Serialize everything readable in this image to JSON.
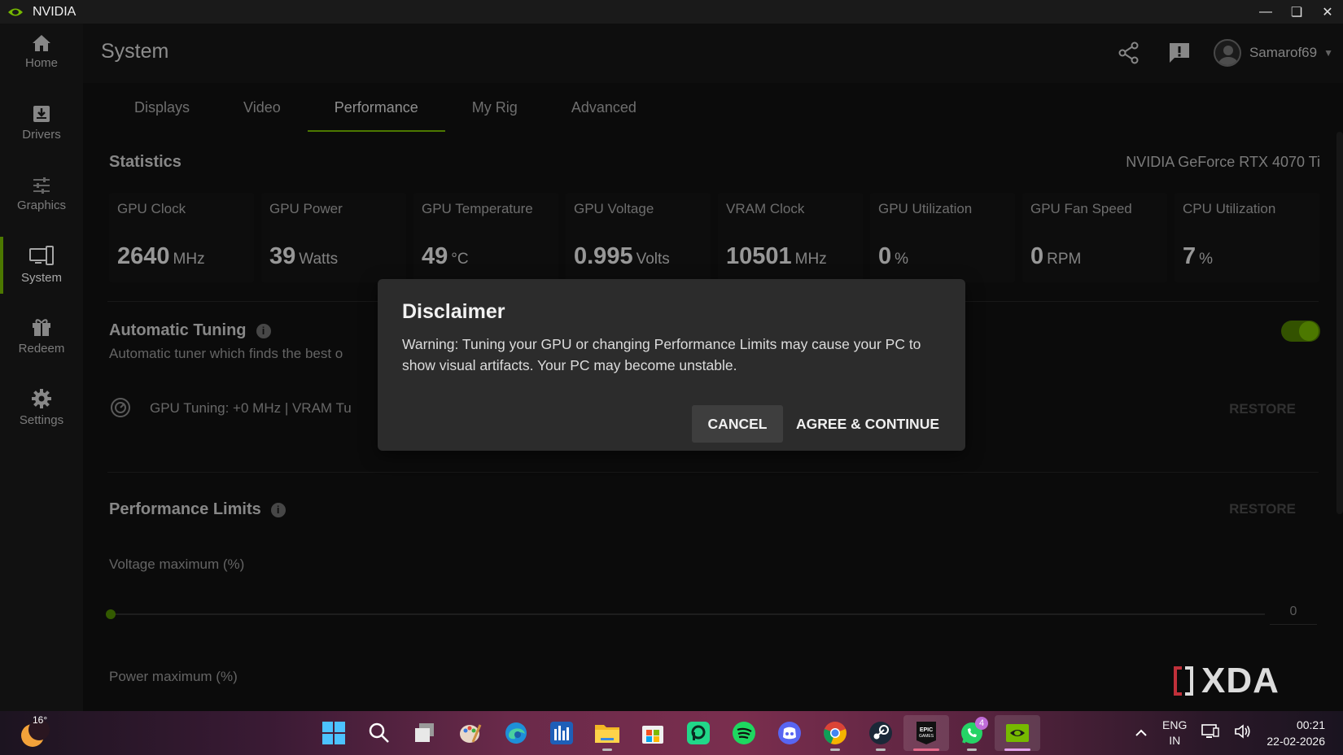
{
  "window": {
    "title": "NVIDIA"
  },
  "sidebar": {
    "items": [
      {
        "label": "Home",
        "icon": "home-icon"
      },
      {
        "label": "Drivers",
        "icon": "download-icon"
      },
      {
        "label": "Graphics",
        "icon": "sliders-icon"
      },
      {
        "label": "System",
        "icon": "system-icon",
        "active": true
      },
      {
        "label": "Redeem",
        "icon": "gift-icon"
      },
      {
        "label": "Settings",
        "icon": "gear-icon"
      }
    ]
  },
  "header": {
    "title": "System",
    "username": "Samarof69"
  },
  "tabs": [
    {
      "label": "Displays"
    },
    {
      "label": "Video"
    },
    {
      "label": "Performance",
      "active": true
    },
    {
      "label": "My Rig"
    },
    {
      "label": "Advanced"
    }
  ],
  "statistics": {
    "title": "Statistics",
    "gpu_name": "NVIDIA GeForce RTX 4070 Ti",
    "cards": [
      {
        "label": "GPU Clock",
        "value": "2640",
        "unit": "MHz"
      },
      {
        "label": "GPU Power",
        "value": "39",
        "unit": "Watts"
      },
      {
        "label": "GPU Temperature",
        "value": "49",
        "unit": "°C"
      },
      {
        "label": "GPU Voltage",
        "value": "0.995",
        "unit": "Volts"
      },
      {
        "label": "VRAM Clock",
        "value": "10501",
        "unit": "MHz"
      },
      {
        "label": "GPU Utilization",
        "value": "0",
        "unit": "%"
      },
      {
        "label": "GPU Fan Speed",
        "value": "0",
        "unit": "RPM"
      },
      {
        "label": "CPU Utilization",
        "value": "7",
        "unit": "%"
      }
    ]
  },
  "auto_tuning": {
    "title": "Automatic Tuning",
    "description": "Automatic tuner which finds the best o",
    "tuning_text": "GPU Tuning: +0 MHz  |  VRAM Tu",
    "restore_label": "RESTORE",
    "enabled": true
  },
  "performance_limits": {
    "title": "Performance Limits",
    "restore_label": "RESTORE",
    "voltage_label": "Voltage maximum (%)",
    "voltage_value": "0",
    "power_label": "Power maximum (%)"
  },
  "modal": {
    "title": "Disclaimer",
    "body": "Warning: Tuning your GPU or changing Performance Limits may cause your PC to show visual artifacts. Your PC may become unstable.",
    "cancel_label": "CANCEL",
    "agree_label": "AGREE & CONTINUE"
  },
  "watermark": {
    "text": "XDA"
  },
  "taskbar": {
    "weather_temp": "16°",
    "whatsapp_badge": "4",
    "language_line1": "ENG",
    "language_line2": "IN",
    "time": "00:21",
    "date": "22-02-2026"
  },
  "colors": {
    "accent": "#76b900",
    "background": "#111111",
    "modal": "#2c2c2c"
  }
}
